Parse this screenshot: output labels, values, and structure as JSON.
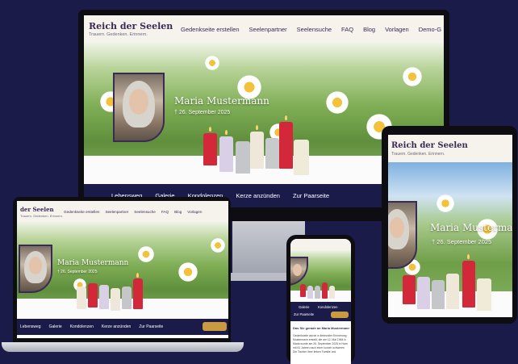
{
  "brand": {
    "logo": "Reich der Seelen",
    "logo_cut": "der Seelen",
    "tagline": "Trauern. Gedenken. Erinnern."
  },
  "desktop_nav": [
    "Gedenkseite erstellen",
    "Seelenpartner",
    "Seelensuche",
    "FAQ",
    "Blog",
    "Vorlagen",
    "Demo-G"
  ],
  "laptop_nav": [
    "Gedenkseite erstellen",
    "Seelenpartner",
    "Seelensuche",
    "FAQ",
    "Blog",
    "Vorlagen"
  ],
  "memorial": {
    "name": "Maria Mustermann",
    "date": "† 26. September 2025"
  },
  "section_nav": [
    "Lebensweg",
    "Galerie",
    "Kondolenzen",
    "Kerze anzünden",
    "Zur Paarseite"
  ],
  "phone": {
    "section_nav": [
      "Galerie",
      "Kondolenzen"
    ],
    "pair_link": "Zur Paarseite",
    "heading": "Das Sie gerade an Maria Mustermann",
    "text_lines": [
      "Gedenkseite wurde in liebevoller Erinnerung",
      "Mustermann erstellt, die am 12. Mai 1964 in",
      "Maria wurde am 26. September 2025 in Ham",
      "mit 61 Jahren nach einer kurzen schweren",
      "Die Tochter ihrer lieben Familie und"
    ]
  },
  "colors": {
    "navy": "#1b1b4a",
    "brand_purple": "#3a2a55",
    "header_bg": "#f6f2ec",
    "accent_gold": "#c99a3f"
  }
}
